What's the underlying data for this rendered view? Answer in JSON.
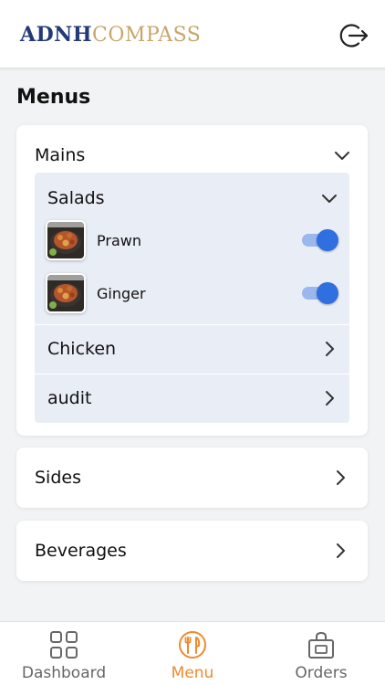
{
  "header": {
    "logo_part1": "ADNH",
    "logo_part2": "COMPASS",
    "logout_icon": "logout-icon"
  },
  "page_title": "Menus",
  "menus": {
    "mains": {
      "label": "Mains",
      "expanded": true,
      "submenus": {
        "salads": {
          "label": "Salads",
          "expanded": true,
          "items": [
            {
              "label": "Prawn",
              "enabled": true
            },
            {
              "label": "Ginger",
              "enabled": true
            }
          ]
        },
        "chicken": {
          "label": "Chicken"
        },
        "audit": {
          "label": "audit"
        }
      }
    },
    "sides": {
      "label": "Sides"
    },
    "beverages": {
      "label": "Beverages"
    }
  },
  "bottom_nav": {
    "items": [
      {
        "label": "Dashboard",
        "icon": "dashboard-grid-icon",
        "active": false
      },
      {
        "label": "Menu",
        "icon": "cutlery-icon",
        "active": true
      },
      {
        "label": "Orders",
        "icon": "shopping-bag-icon",
        "active": false
      }
    ]
  },
  "colors": {
    "brand_blue": "#233a78",
    "brand_gold": "#c8a66a",
    "toggle_on": "#2f6fe0",
    "active_nav": "#ee8a2f",
    "sub_panel_bg": "#e9edf5"
  }
}
